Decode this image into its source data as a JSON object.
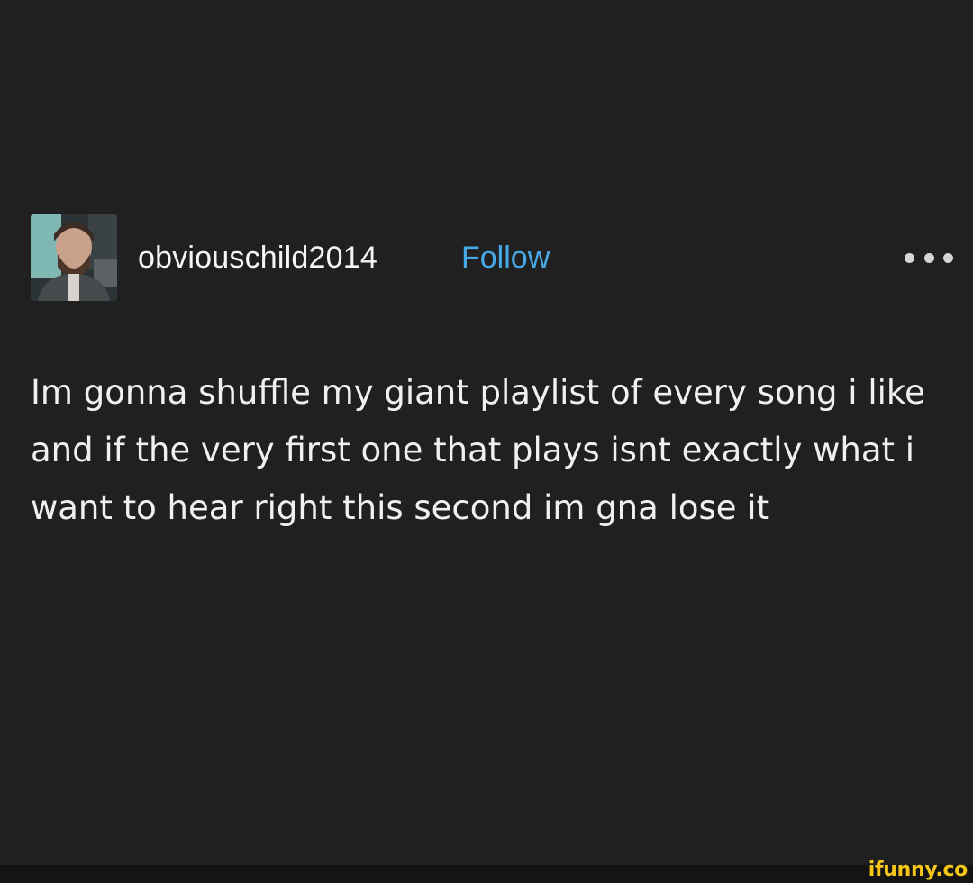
{
  "post": {
    "author": {
      "username": "obviouschild2014",
      "avatar_icon": "user-avatar-photo"
    },
    "follow_label": "Follow",
    "more_icon": "ellipsis-icon",
    "text": "Im gonna shuffle my giant playlist of every song i like and if the very first one that plays isnt exactly what i want to hear right this second im gna lose it"
  },
  "watermark": {
    "text": "ifunny.co"
  },
  "colors": {
    "background": "#202020",
    "follow": "#48a8e6",
    "text": "#f0f0f0",
    "watermark": "#f5c518"
  }
}
